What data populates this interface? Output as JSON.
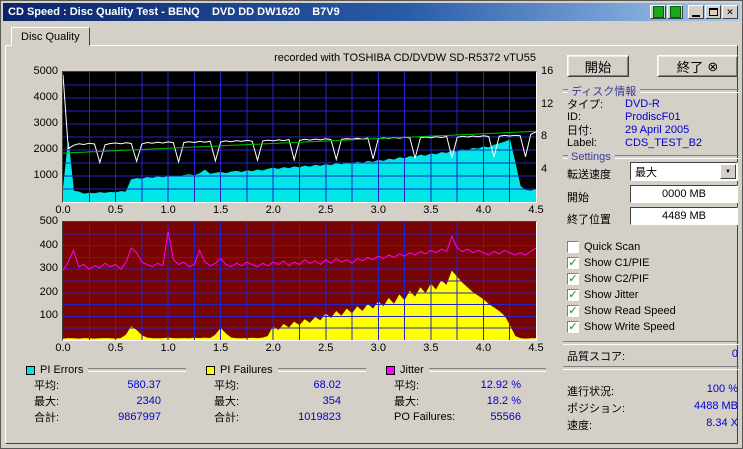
{
  "window": {
    "title": "CD Speed : Disc Quality Test - BENQ    DVD DD DW1620    B7V9"
  },
  "icons": {
    "close": "✕",
    "exit": "⊗",
    "dropdown_arrow": "▼",
    "checkbox_check": "✓"
  },
  "tab": {
    "label": "Disc Quality"
  },
  "note": "recorded with TOSHIBA CD/DVDW SD-R5372 vTU55",
  "actions": {
    "start": "開始",
    "exit": "終了"
  },
  "disc_info": {
    "header": "ディスク情報",
    "rows": [
      {
        "label": "タイプ:",
        "value": "DVD-R"
      },
      {
        "label": "ID:",
        "value": "ProdiscF01"
      },
      {
        "label": "日付:",
        "value": "29 April 2005"
      },
      {
        "label": "Label:",
        "value": "CDS_TEST_B2"
      }
    ]
  },
  "settings": {
    "header": "Settings",
    "transfer_label": "転送速度",
    "transfer_value": "最大",
    "start_label": "開始",
    "start_value": "0000 MB",
    "end_label": "終了位置",
    "end_value": "4489 MB",
    "checkboxes": [
      {
        "label": "Quick Scan",
        "checked": false
      },
      {
        "label": "Show C1/PIE",
        "checked": true
      },
      {
        "label": "Show C2/PIF",
        "checked": true
      },
      {
        "label": "Show Jitter",
        "checked": true
      },
      {
        "label": "Show Read Speed",
        "checked": true
      },
      {
        "label": "Show Write Speed",
        "checked": true
      }
    ]
  },
  "quality": {
    "label": "品質スコア:",
    "value": "0"
  },
  "status": {
    "rows": [
      {
        "label": "進行状況:",
        "value": "100 %"
      },
      {
        "label": "ポジション:",
        "value": "4488 MB"
      },
      {
        "label": "速度:",
        "value": "8.34 X"
      }
    ]
  },
  "stats": {
    "groups": [
      {
        "legend": "PI Errors",
        "color": "#00e5e5",
        "rows": [
          {
            "label": "平均:",
            "value": "580.37"
          },
          {
            "label": "最大:",
            "value": "2340"
          },
          {
            "label": "合計:",
            "value": "9867997"
          }
        ]
      },
      {
        "legend": "PI Failures",
        "color": "#ffff00",
        "rows": [
          {
            "label": "平均:",
            "value": "68.02"
          },
          {
            "label": "最大:",
            "value": "354"
          },
          {
            "label": "合計:",
            "value": "1019823"
          }
        ]
      },
      {
        "legend": "Jitter",
        "color": "#ff00ff",
        "rows": [
          {
            "label": "平均:",
            "value": "12.92 %"
          },
          {
            "label": "最大:",
            "value": "18.2 %"
          },
          {
            "label": "PO Failures:",
            "value": "55566"
          }
        ]
      }
    ]
  },
  "chart_data": [
    {
      "type": "area",
      "title": "PI Errors / Speed scan",
      "bg": "#000000",
      "grid_color": "#2424c8",
      "x_start": 0,
      "x_step": 0.05,
      "xlim": [
        0,
        4.5
      ],
      "x_grid_step": 0.25,
      "ylim_left": [
        0,
        5000
      ],
      "y_grid_step": 500,
      "ylim_right": [
        0,
        16
      ],
      "y_ticks_left": [
        "5000",
        "4000",
        "3000",
        "2000",
        "1000"
      ],
      "y_ticks_right": [
        "16",
        "12",
        "8",
        "4"
      ],
      "x_ticks": [
        "0.0",
        "0.5",
        "1.0",
        "1.5",
        "2.0",
        "2.5",
        "3.0",
        "3.5",
        "4.0",
        "4.5"
      ],
      "series": [
        {
          "name": "pi-errors",
          "type": "area",
          "color": "#00e5e5",
          "values": [
            350,
            2300,
            420,
            380,
            300,
            340,
            320,
            360,
            330,
            370,
            350,
            400,
            380,
            850,
            900,
            880,
            940,
            910,
            960,
            930,
            980,
            1000,
            960,
            1020,
            1050,
            1010,
            1080,
            1220,
            1060,
            1100,
            1140,
            1090,
            1150,
            1180,
            1130,
            1200,
            1160,
            1230,
            1190,
            1260,
            1300,
            1250,
            1320,
            1280,
            1350,
            1310,
            1380,
            1340,
            1410,
            1370,
            1440,
            1400,
            1470,
            1430,
            1500,
            1460,
            1530,
            1490,
            1560,
            1520,
            1600,
            1560,
            1650,
            1610,
            1700,
            1660,
            1750,
            1710,
            1800,
            1760,
            1850,
            1810,
            1900,
            1870,
            1960,
            1920,
            2010,
            1970,
            2060,
            2030,
            2120,
            2080,
            2180,
            2240,
            2300,
            2380,
            1500,
            600,
            450,
            420,
            480
          ]
        },
        {
          "name": "write-speed",
          "type": "line",
          "color": "#ffffff",
          "values": [
            4900,
            2050,
            2180,
            2240,
            2210,
            2260,
            2230,
            1520,
            2200,
            2250,
            2270,
            2240,
            2280,
            2250,
            1560,
            2230,
            2290,
            2260,
            2300,
            2270,
            2310,
            2280,
            1540,
            2290,
            2320,
            2290,
            2330,
            2300,
            2340,
            1580,
            2310,
            2350,
            2320,
            2360,
            2330,
            2370,
            2340,
            1600,
            2350,
            2380,
            2350,
            2390,
            2360,
            2400,
            1620,
            2370,
            2410,
            2380,
            2420,
            2390,
            2430,
            2400,
            1640,
            2410,
            2440,
            2410,
            2450,
            2420,
            2460,
            1660,
            2430,
            2470,
            2440,
            2480,
            2450,
            2490,
            2460,
            1680,
            2470,
            2500,
            2470,
            2510,
            2480,
            2520,
            1700,
            2490,
            2530,
            2500,
            2540,
            2510,
            2550,
            2520,
            1720,
            2530,
            2560,
            2540,
            2570,
            2550,
            1740,
            2600,
            2700
          ]
        },
        {
          "name": "read-speed",
          "type": "line",
          "color": "#00c000",
          "values": [
            1880,
            1889,
            1899,
            1908,
            1917,
            1927,
            1936,
            1945,
            1955,
            1964,
            1973,
            1983,
            1992,
            2001,
            2011,
            2020,
            2029,
            2039,
            2048,
            2057,
            2067,
            2076,
            2085,
            2095,
            2104,
            2113,
            2123,
            2132,
            2141,
            2151,
            2160,
            2169,
            2179,
            2188,
            2197,
            2207,
            2216,
            2225,
            2235,
            2244,
            2253,
            2263,
            2272,
            2281,
            2291,
            2300,
            2309,
            2319,
            2328,
            2337,
            2347,
            2356,
            2365,
            2375,
            2384,
            2393,
            2403,
            2412,
            2421,
            2431,
            2440,
            2449,
            2459,
            2468,
            2477,
            2487,
            2496,
            2505,
            2515,
            2524,
            2533,
            2543,
            2552,
            2561,
            2571,
            2580,
            2589,
            2599,
            2608,
            2617,
            2627,
            2636,
            2645,
            2655,
            2664,
            2673,
            2683,
            2692,
            2701,
            2711,
            2720
          ]
        }
      ]
    },
    {
      "type": "area",
      "title": "PI Failures / Jitter",
      "bg": "#7a0404",
      "grid_color": "#2424c8",
      "x_start": 0,
      "x_step": 0.05,
      "xlim": [
        0,
        4.5
      ],
      "x_grid_step": 0.25,
      "ylim_left": [
        0,
        500
      ],
      "y_grid_step": 50,
      "y_ticks_left": [
        "500",
        "400",
        "300",
        "200",
        "100"
      ],
      "x_ticks": [
        "0.0",
        "0.5",
        "1.0",
        "1.5",
        "2.0",
        "2.5",
        "3.0",
        "3.5",
        "4.0",
        "4.5"
      ],
      "series": [
        {
          "name": "pi-failures",
          "type": "area",
          "color": "#ffff00",
          "values": [
            4,
            6,
            5,
            4,
            6,
            5,
            4,
            5,
            6,
            5,
            4,
            6,
            20,
            55,
            40,
            18,
            8,
            6,
            5,
            6,
            8,
            6,
            5,
            6,
            5,
            7,
            6,
            8,
            6,
            20,
            48,
            25,
            8,
            6,
            5,
            6,
            7,
            6,
            8,
            15,
            55,
            40,
            65,
            50,
            75,
            60,
            85,
            70,
            95,
            80,
            110,
            90,
            120,
            100,
            130,
            110,
            140,
            120,
            150,
            130,
            160,
            140,
            175,
            150,
            190,
            165,
            205,
            180,
            220,
            195,
            235,
            210,
            250,
            230,
            290,
            265,
            240,
            220,
            200,
            185,
            170,
            150,
            135,
            120,
            100,
            60,
            15,
            6,
            4,
            5,
            6
          ]
        },
        {
          "name": "jitter",
          "type": "line",
          "color": "#ff00ff",
          "values": [
            295,
            330,
            380,
            310,
            320,
            300,
            315,
            305,
            325,
            310,
            320,
            300,
            330,
            390,
            370,
            330,
            320,
            310,
            325,
            315,
            460,
            340,
            320,
            330,
            310,
            320,
            380,
            330,
            315,
            325,
            345,
            320,
            310,
            325,
            315,
            330,
            320,
            310,
            325,
            315,
            330,
            320,
            335,
            315,
            330,
            320,
            340,
            325,
            335,
            320,
            340,
            325,
            345,
            330,
            340,
            325,
            345,
            335,
            350,
            340,
            355,
            345,
            360,
            350,
            365,
            355,
            370,
            360,
            375,
            365,
            380,
            370,
            385,
            375,
            440,
            390,
            375,
            385,
            370,
            380,
            370,
            360,
            375,
            365,
            380,
            370,
            360,
            370,
            360,
            375,
            390
          ]
        }
      ]
    }
  ]
}
